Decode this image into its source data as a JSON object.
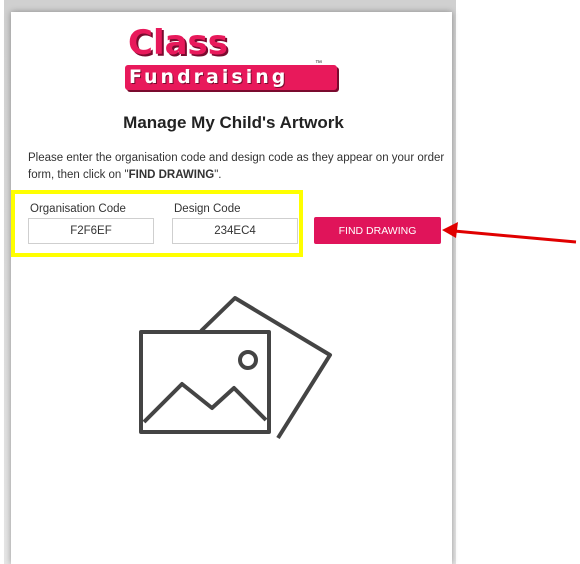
{
  "logo": {
    "line1": "Class",
    "line2": "Fundraising",
    "tm": "™"
  },
  "page": {
    "title": "Manage My Child's Artwork",
    "instructions_prefix": "Please enter the organisation code and design code as they appear on your order form, then click on \"",
    "instructions_bold": "FIND DRAWING",
    "instructions_suffix": "\"."
  },
  "form": {
    "org_label": "Organisation Code",
    "org_value": "F2F6EF",
    "design_label": "Design Code",
    "design_value": "234EC4",
    "find_button": "FIND DRAWING"
  },
  "colors": {
    "brand": "#e8195b",
    "button": "#e0145a",
    "highlight": "#ffff00",
    "arrow": "#e00000"
  },
  "icons": {
    "placeholder": "image-placeholder-icon",
    "arrow": "red-arrow-annotation"
  }
}
